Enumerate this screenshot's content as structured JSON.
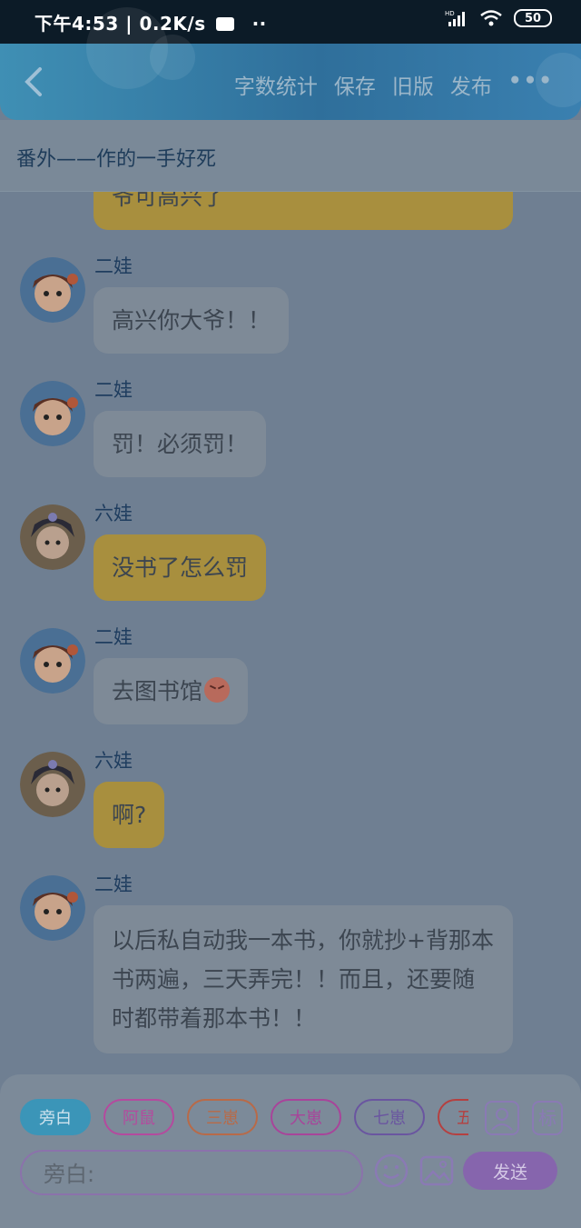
{
  "status_bar": {
    "time_speed": "下午4:53 | 0.2K/s",
    "more_dots": "··",
    "hd": "HD",
    "battery": "50"
  },
  "header": {
    "actions": [
      "字数统计",
      "保存",
      "旧版",
      "发布"
    ],
    "more": "•••"
  },
  "chapter_title": "番外——作的一手好死",
  "messages": [
    {
      "speaker": "",
      "text": "爷可高兴了",
      "color": "yellow"
    },
    {
      "speaker": "二娃",
      "text": "高兴你大爷！！",
      "color": "grey"
    },
    {
      "speaker": "二娃",
      "text": "罚！必须罚！",
      "color": "grey"
    },
    {
      "speaker": "六娃",
      "text": "没书了怎么罚",
      "color": "yellow"
    },
    {
      "speaker": "二娃",
      "text": "去图书馆",
      "color": "grey"
    },
    {
      "speaker": "六娃",
      "text": "啊?",
      "color": "yellow"
    },
    {
      "speaker": "二娃",
      "text": "以后私自动我一本书，你就抄+背那本书两遍，三天弄完！！而且，还要随时都带着那本书！！",
      "color": "grey"
    }
  ],
  "role_chips": [
    {
      "label": "旁白",
      "color": "#3b95b8"
    },
    {
      "label": "阿鼠",
      "color": "#b44a9e"
    },
    {
      "label": "三崽",
      "color": "#b86a48"
    },
    {
      "label": "大崽",
      "color": "#a8449a"
    },
    {
      "label": "七崽",
      "color": "#6a55a0"
    },
    {
      "label": "五崽",
      "color": "#b54040"
    }
  ],
  "input": {
    "placeholder": "旁白:"
  },
  "send_label": "发送",
  "icons": {
    "back": "chevron-left-icon",
    "character": "person-card-icon",
    "tag": "tag-icon",
    "emoji": "smile-icon",
    "image": "image-icon",
    "angry": "angry-face-icon"
  }
}
